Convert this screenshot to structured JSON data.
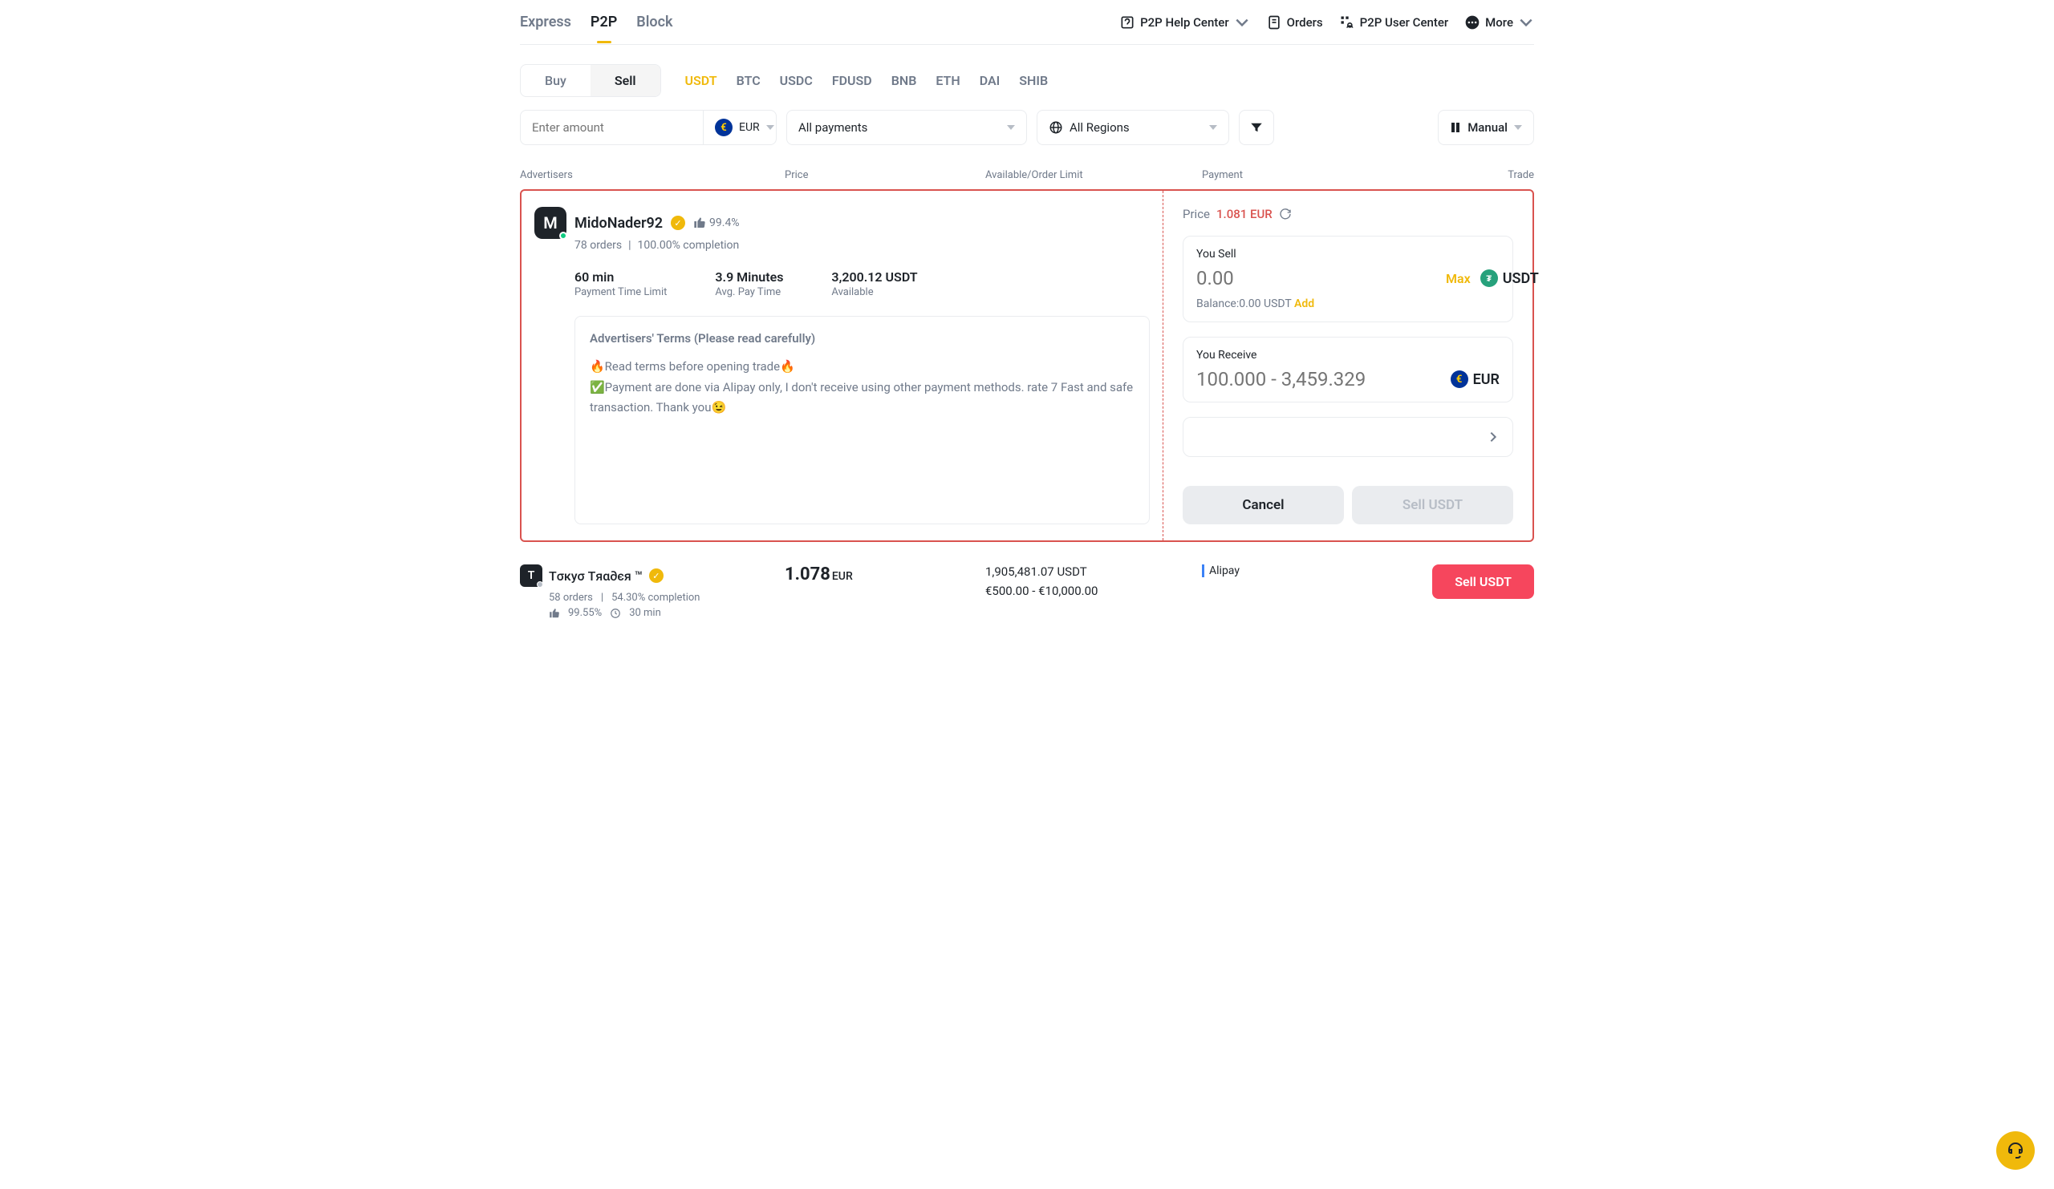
{
  "top": {
    "tabs": [
      "Express",
      "P2P",
      "Block"
    ],
    "active_tab": 1,
    "right_items": {
      "help": "P2P Help Center",
      "orders": "Orders",
      "user_center": "P2P User Center",
      "more": "More"
    }
  },
  "buysell": {
    "buy": "Buy",
    "sell": "Sell",
    "active": "sell"
  },
  "coins": [
    "USDT",
    "BTC",
    "USDC",
    "FDUSD",
    "BNB",
    "ETH",
    "DAI",
    "SHIB"
  ],
  "active_coin": 0,
  "filters": {
    "amount_placeholder": "Enter amount",
    "currency": "EUR",
    "payments": "All payments",
    "regions": "All Regions",
    "manual": "Manual"
  },
  "headers": [
    "Advertisers",
    "Price",
    "Available/Order Limit",
    "Payment",
    "Trade"
  ],
  "ad": {
    "avatar_letter": "M",
    "name": "MidoNader92",
    "rating": "99.4%",
    "orders": "78 orders",
    "completion": "100.00% completion",
    "stats": {
      "time_limit": "60 min",
      "time_limit_label": "Payment Time Limit",
      "avg_pay": "3.9 Minutes",
      "avg_pay_label": "Avg. Pay Time",
      "available": "3,200.12 USDT",
      "available_label": "Available"
    },
    "terms_header": "Advertisers' Terms (Please read carefully)",
    "terms_body": "🔥Read terms before opening trade🔥\n✅Payment are done via Alipay only, I don't receive using other payment methods. rate 7 Fast and safe transaction. Thank you😉"
  },
  "trade": {
    "price_label": "Price",
    "price_value": "1.081 EUR",
    "you_sell": "You Sell",
    "sell_value": "0.00",
    "max": "Max",
    "sell_unit": "USDT",
    "balance": "Balance:0.00 USDT",
    "add": "Add",
    "you_receive": "You Receive",
    "receive_placeholder": "100.000 - 3,459.329",
    "receive_unit": "EUR",
    "cancel": "Cancel",
    "sell_btn": "Sell USDT"
  },
  "row2": {
    "avatar_letter": "T",
    "name": "Tσкуσ Tяα∂єя ™",
    "orders": "58 orders",
    "completion": "54.30% completion",
    "rating": "99.55%",
    "time": "30 min",
    "price": "1.078",
    "price_unit": "EUR",
    "available": "1,905,481.07 USDT",
    "limit": "€500.00 - €10,000.00",
    "payment": "Alipay",
    "sell": "Sell USDT"
  }
}
